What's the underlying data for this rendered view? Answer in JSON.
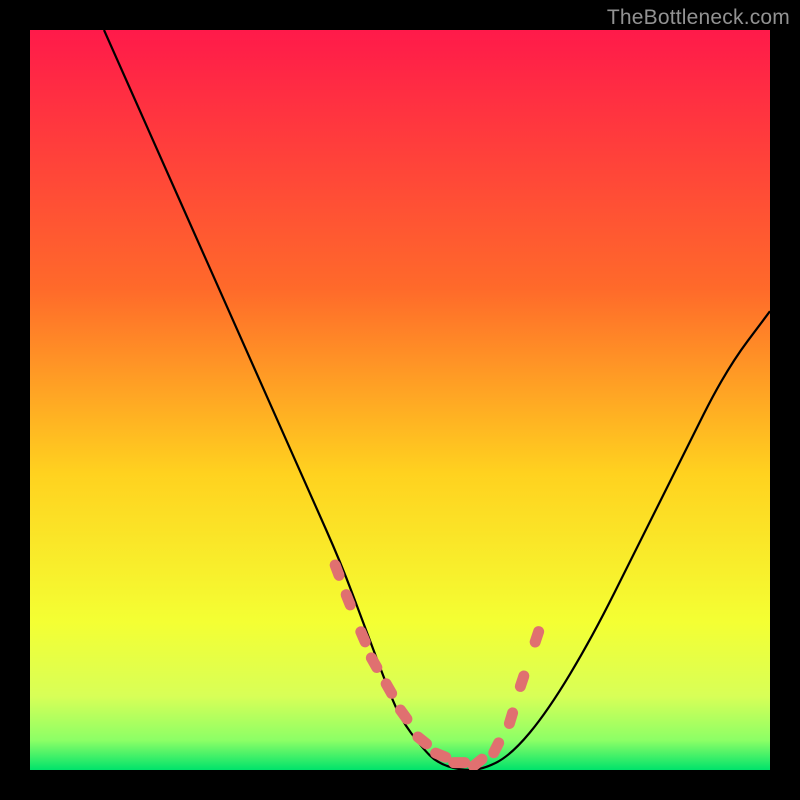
{
  "attribution": "TheBottleneck.com",
  "chart_data": {
    "type": "line",
    "title": "",
    "xlabel": "",
    "ylabel": "",
    "xlim": [
      0,
      100
    ],
    "ylim": [
      0,
      100
    ],
    "gradient_stops": [
      {
        "offset": 0,
        "color": "#ff1a4a"
      },
      {
        "offset": 0.35,
        "color": "#ff6a2a"
      },
      {
        "offset": 0.6,
        "color": "#ffd21f"
      },
      {
        "offset": 0.8,
        "color": "#f4ff33"
      },
      {
        "offset": 0.9,
        "color": "#d8ff57"
      },
      {
        "offset": 0.96,
        "color": "#8cff66"
      },
      {
        "offset": 1.0,
        "color": "#00e36b"
      }
    ],
    "series": [
      {
        "name": "bottleneck-curve",
        "color": "#000000",
        "x": [
          10,
          14,
          18,
          22,
          26,
          30,
          34,
          38,
          42,
          45,
          48,
          50,
          53,
          55,
          58,
          61,
          65,
          70,
          76,
          82,
          88,
          94,
          100
        ],
        "y": [
          100,
          91,
          82,
          73,
          64,
          55,
          46,
          37,
          28,
          20,
          12,
          7,
          3,
          1,
          0,
          0,
          2,
          8,
          18,
          30,
          42,
          54,
          62
        ]
      }
    ],
    "markers": {
      "name": "curve-dots",
      "color": "#e07070",
      "x": [
        41.5,
        43,
        45,
        46.5,
        48.5,
        50.5,
        53,
        55.5,
        58,
        60.5,
        63,
        65,
        66.5,
        68.5
      ],
      "y": [
        27,
        23,
        18,
        14.5,
        11,
        7.5,
        4,
        2,
        1,
        1,
        3,
        7,
        12,
        18
      ]
    }
  }
}
